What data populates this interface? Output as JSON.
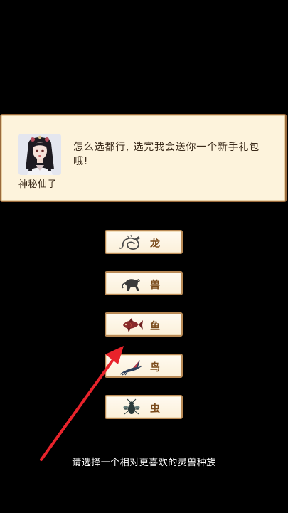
{
  "dialog": {
    "npc_name": "神秘仙子",
    "text": "怎么选都行, 选完我会送你一个新手礼包哦!"
  },
  "choices": [
    {
      "label": "龙",
      "icon": "dragon-icon"
    },
    {
      "label": "兽",
      "icon": "beast-icon"
    },
    {
      "label": "鱼",
      "icon": "fish-icon"
    },
    {
      "label": "鸟",
      "icon": "bird-icon"
    },
    {
      "label": "虫",
      "icon": "insect-icon"
    }
  ],
  "prompt": "请选择一个相对更喜欢的灵兽种族",
  "colors": {
    "background": "#000000",
    "dialog_bg": "#fdf3dc",
    "dialog_border": "#9a6a3c",
    "button_text": "#7a4a1a",
    "arrow": "#e8232b"
  }
}
